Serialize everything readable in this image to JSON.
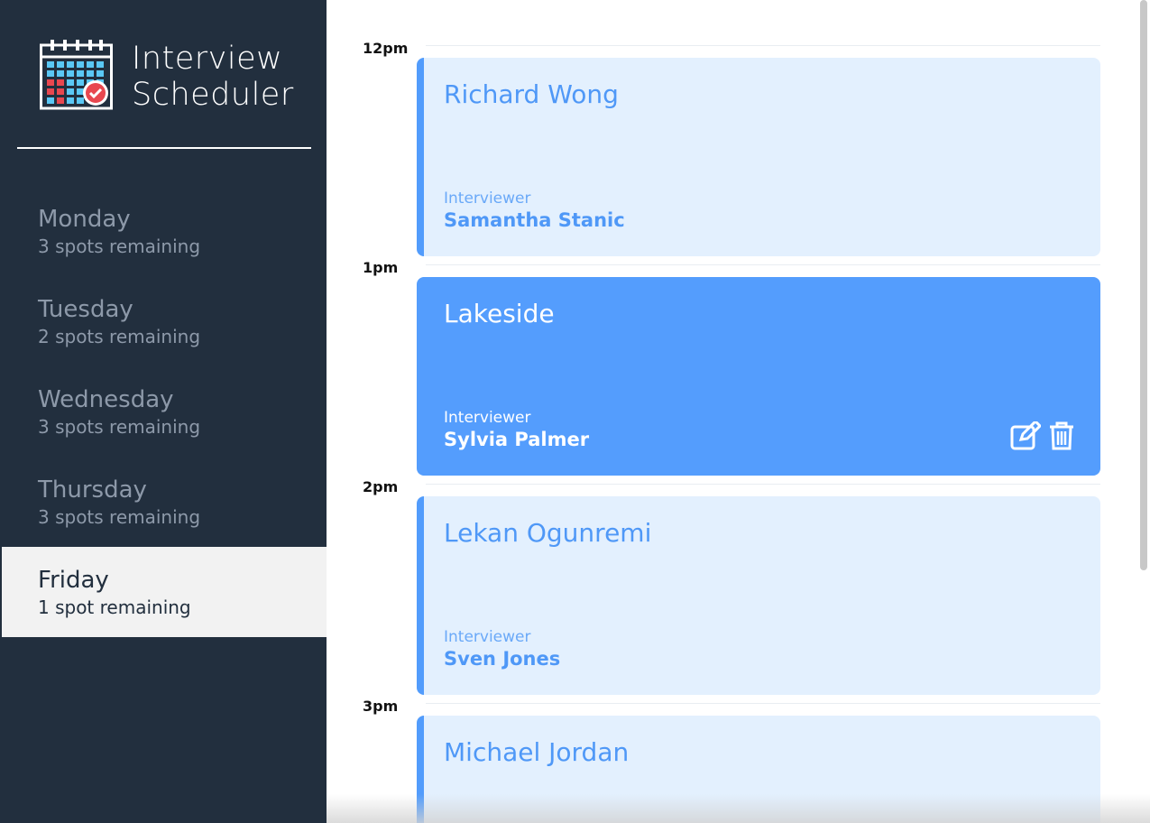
{
  "brand": {
    "line1": "Interview",
    "line2": "Scheduler",
    "logo_icon": "calendar-check-icon"
  },
  "days": [
    {
      "name": "Monday",
      "spots": "3 spots remaining",
      "selected": false
    },
    {
      "name": "Tuesday",
      "spots": "2 spots remaining",
      "selected": false
    },
    {
      "name": "Wednesday",
      "spots": "3 spots remaining",
      "selected": false
    },
    {
      "name": "Thursday",
      "spots": "3 spots remaining",
      "selected": false
    },
    {
      "name": "Friday",
      "spots": "1 spot remaining",
      "selected": true
    }
  ],
  "schedule": {
    "times": [
      "12pm",
      "1pm",
      "2pm",
      "3pm"
    ],
    "appointments": [
      {
        "student": "Richard Wong",
        "interviewer_label": "Interviewer",
        "interviewer": "Samantha Stanic",
        "state": "normal"
      },
      {
        "student": "Lakeside",
        "interviewer_label": "Interviewer",
        "interviewer": "Sylvia Palmer",
        "state": "hover"
      },
      {
        "student": "Lekan Ogunremi",
        "interviewer_label": "Interviewer",
        "interviewer": "Sven Jones",
        "state": "normal"
      },
      {
        "student": "Michael Jordan",
        "state": "normal"
      }
    ],
    "actions": {
      "edit_icon": "edit-icon",
      "delete_icon": "trash-icon"
    }
  },
  "colors": {
    "sidebar_bg": "#222f3e",
    "accent": "#529cfc",
    "slot_bg": "#e3f0fe",
    "selected_day_bg": "#f2f2f2"
  }
}
